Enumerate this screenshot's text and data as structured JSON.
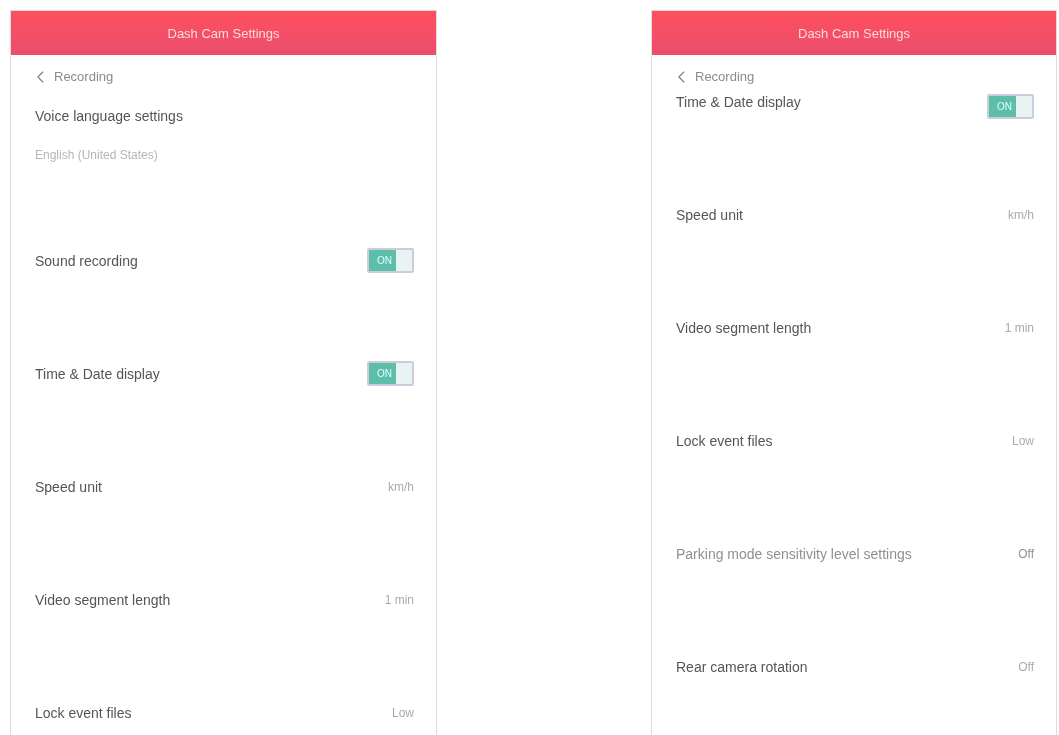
{
  "screens": [
    {
      "header": {
        "title": "Dash Cam Settings"
      },
      "back": {
        "label": "Recording"
      },
      "items": [
        {
          "kind": "info",
          "label": "Voice language settings",
          "sublabel": "English (United States)",
          "disabled": false
        },
        {
          "kind": "toggle",
          "label": "Sound recording",
          "on": true,
          "toggle_text": "ON",
          "disabled": false
        },
        {
          "kind": "toggle",
          "label": "Time & Date display",
          "on": true,
          "toggle_text": "ON",
          "disabled": false
        },
        {
          "kind": "value",
          "label": "Speed unit",
          "value": "km/h",
          "disabled": false
        },
        {
          "kind": "value",
          "label": "Video segment length",
          "value": "1 min",
          "disabled": false
        },
        {
          "kind": "value",
          "label": "Lock event files",
          "value": "Low",
          "disabled": false
        }
      ]
    },
    {
      "header": {
        "title": "Dash Cam Settings"
      },
      "back": {
        "label": "Recording"
      },
      "items": [
        {
          "kind": "toggle",
          "label": "Time & Date display",
          "on": true,
          "toggle_text": "ON",
          "disabled": false
        },
        {
          "kind": "value",
          "label": "Speed unit",
          "value": "km/h",
          "disabled": false
        },
        {
          "kind": "value",
          "label": "Video segment length",
          "value": "1 min",
          "disabled": false
        },
        {
          "kind": "value",
          "label": "Lock event files",
          "value": "Low",
          "disabled": false
        },
        {
          "kind": "value",
          "label": "Parking mode sensitivity level settings",
          "value": "Off",
          "disabled": true
        },
        {
          "kind": "value",
          "label": "Rear camera rotation",
          "value": "Off",
          "disabled": false
        }
      ]
    }
  ]
}
